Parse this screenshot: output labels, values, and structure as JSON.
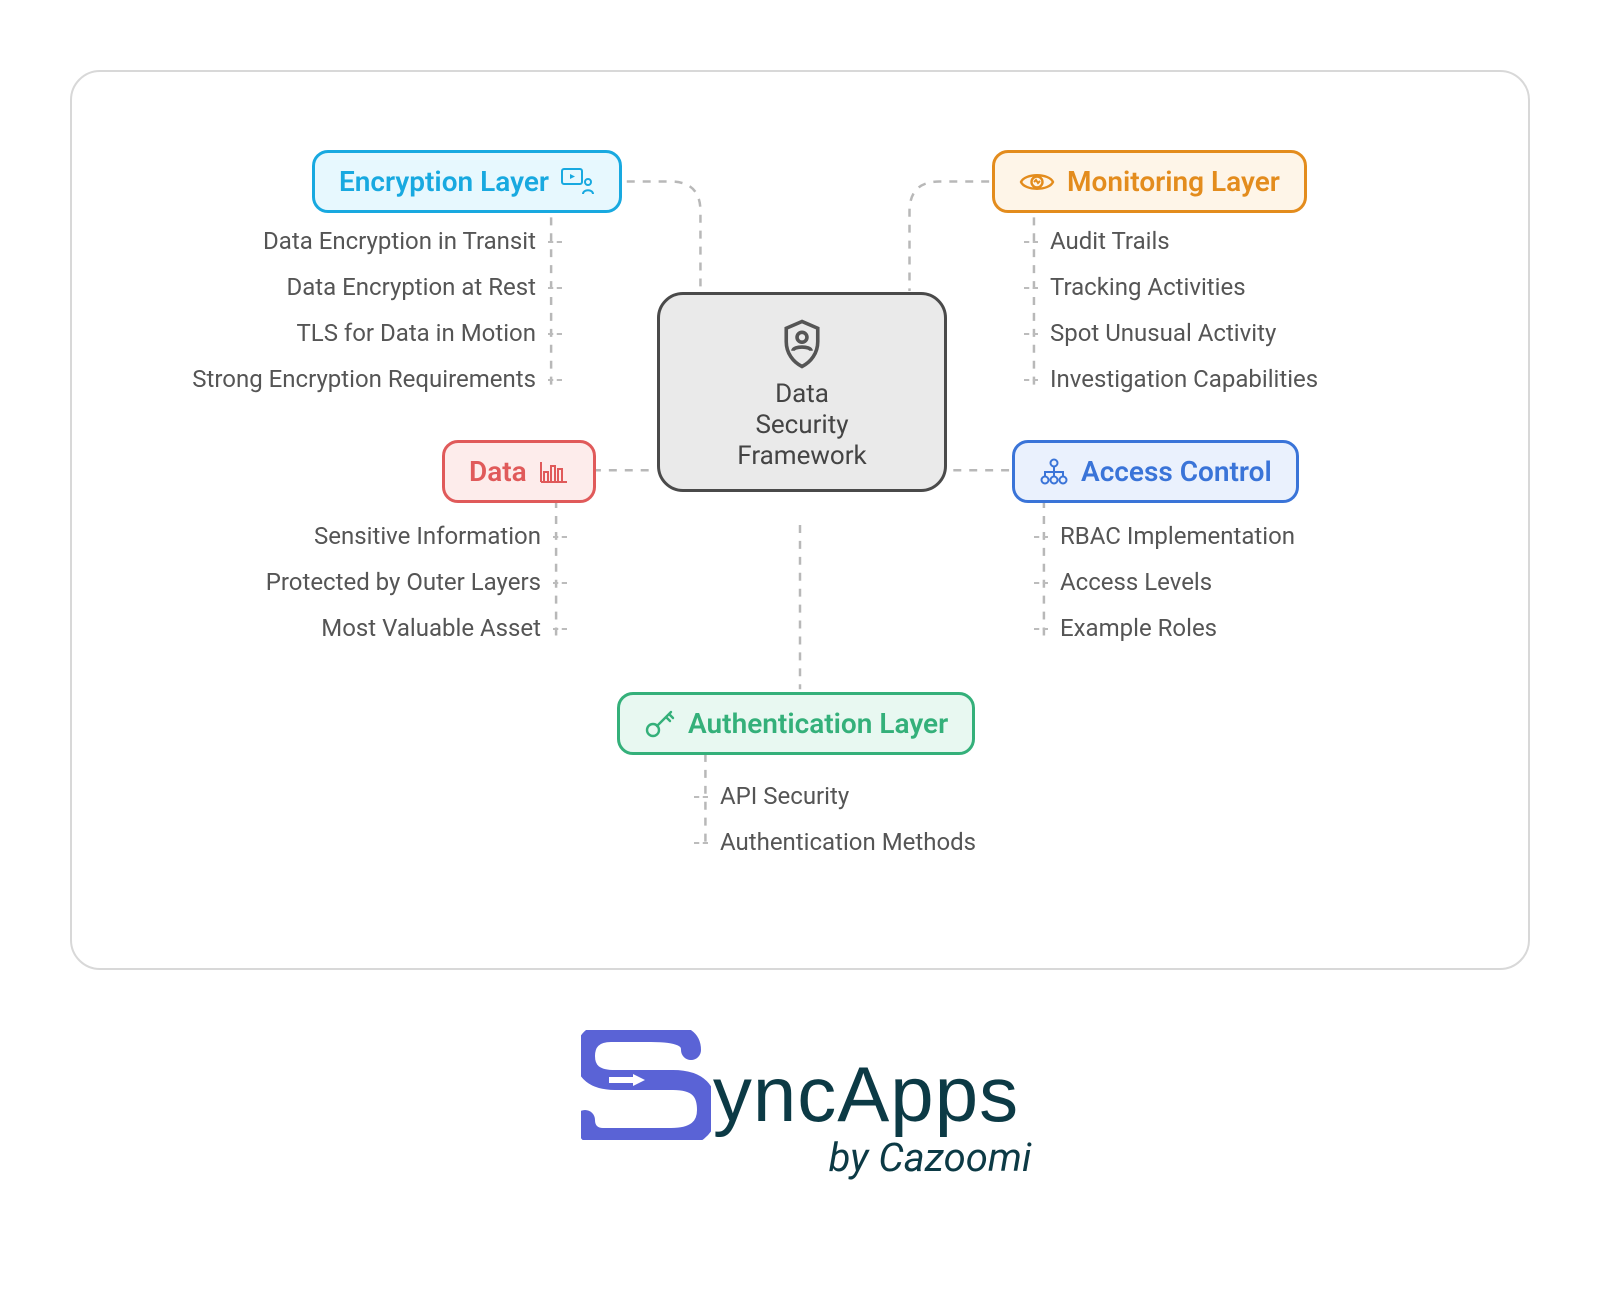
{
  "center": {
    "line1": "Data",
    "line2": "Security",
    "line3": "Framework"
  },
  "branches": {
    "encryption": {
      "label": "Encryption Layer",
      "items": [
        "Data Encryption in Transit",
        "Data Encryption at Rest",
        "TLS for Data in Motion",
        "Strong Encryption Requirements"
      ]
    },
    "monitoring": {
      "label": "Monitoring Layer",
      "items": [
        "Audit Trails",
        "Tracking Activities",
        "Spot Unusual Activity",
        "Investigation Capabilities"
      ]
    },
    "data": {
      "label": "Data",
      "items": [
        "Sensitive Information",
        "Protected by Outer Layers",
        "Most Valuable Asset"
      ]
    },
    "access": {
      "label": "Access Control",
      "items": [
        "RBAC Implementation",
        "Access Levels",
        "Example Roles"
      ]
    },
    "auth": {
      "label": "Authentication Layer",
      "items": [
        "API Security",
        "Authentication Methods"
      ]
    }
  },
  "logo": {
    "brand_suffix": "yncApps",
    "byline": "by Cazoomi"
  }
}
